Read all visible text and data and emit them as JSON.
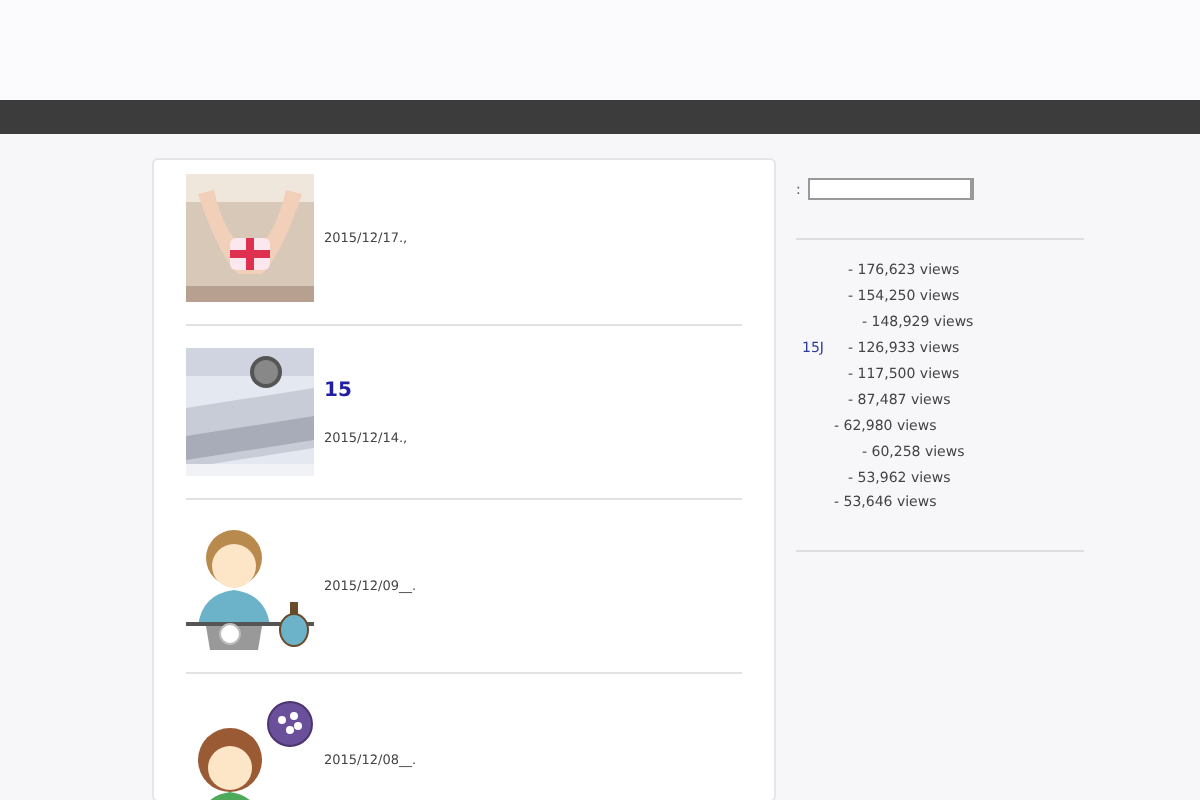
{
  "posts": [
    {
      "date": "2015/12/17.,",
      "kind": "picture"
    },
    {
      "title": "15",
      "date": "2015/12/14.,",
      "kind": "picture"
    },
    {
      "date": "2015/12/09__.",
      "kind": "picture"
    },
    {
      "date": "2015/12/08__.",
      "kind": "picture"
    }
  ],
  "sidebar": {
    "search_label": ":",
    "ranking": [
      {
        "views": "- 176,623 views"
      },
      {
        "views": "- 154,250 views"
      },
      {
        "views": "- 148,929 views"
      },
      {
        "link": "15J",
        "views": "- 126,933 views"
      },
      {
        "views": "- 117,500 views"
      },
      {
        "views": "- 87,487 views"
      },
      {
        "views": "- 62,980 views"
      },
      {
        "views": "- 60,258 views"
      },
      {
        "views": "- 53,962 views"
      },
      {
        "views": "- 53,646 views"
      }
    ]
  }
}
